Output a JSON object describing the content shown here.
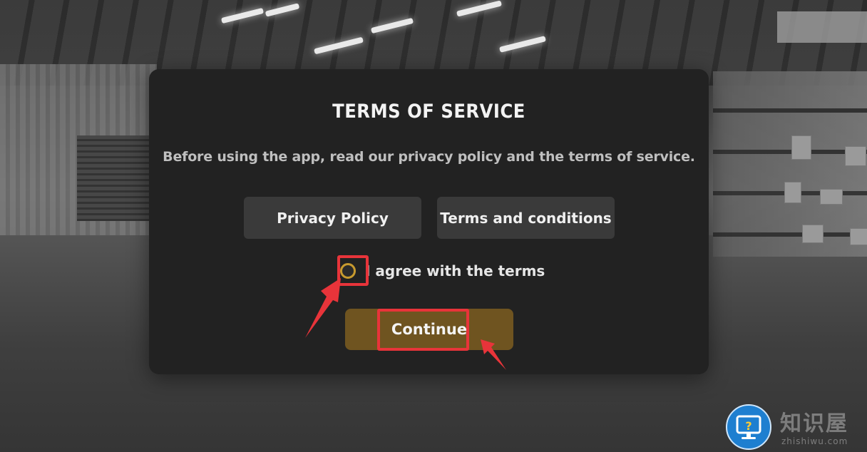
{
  "dialog": {
    "title": "TERMS OF SERVICE",
    "message": "Before using the app, read our privacy policy and the terms of service.",
    "privacy_button_label": "Privacy Policy",
    "terms_button_label": "Terms and conditions",
    "agree_label": "I agree with the terms",
    "agree_checked": false,
    "continue_label": "Continue"
  },
  "colors": {
    "dialog_background": "#222222",
    "button_background": "#3a3a3a",
    "continue_background": "#6f5420",
    "checkbox_ring": "#c79a2e",
    "annotation_red": "#e8343a"
  },
  "watermark": {
    "text": "知识屋",
    "sub": "zhishiwu.com",
    "icon": "question-monitor-icon"
  }
}
